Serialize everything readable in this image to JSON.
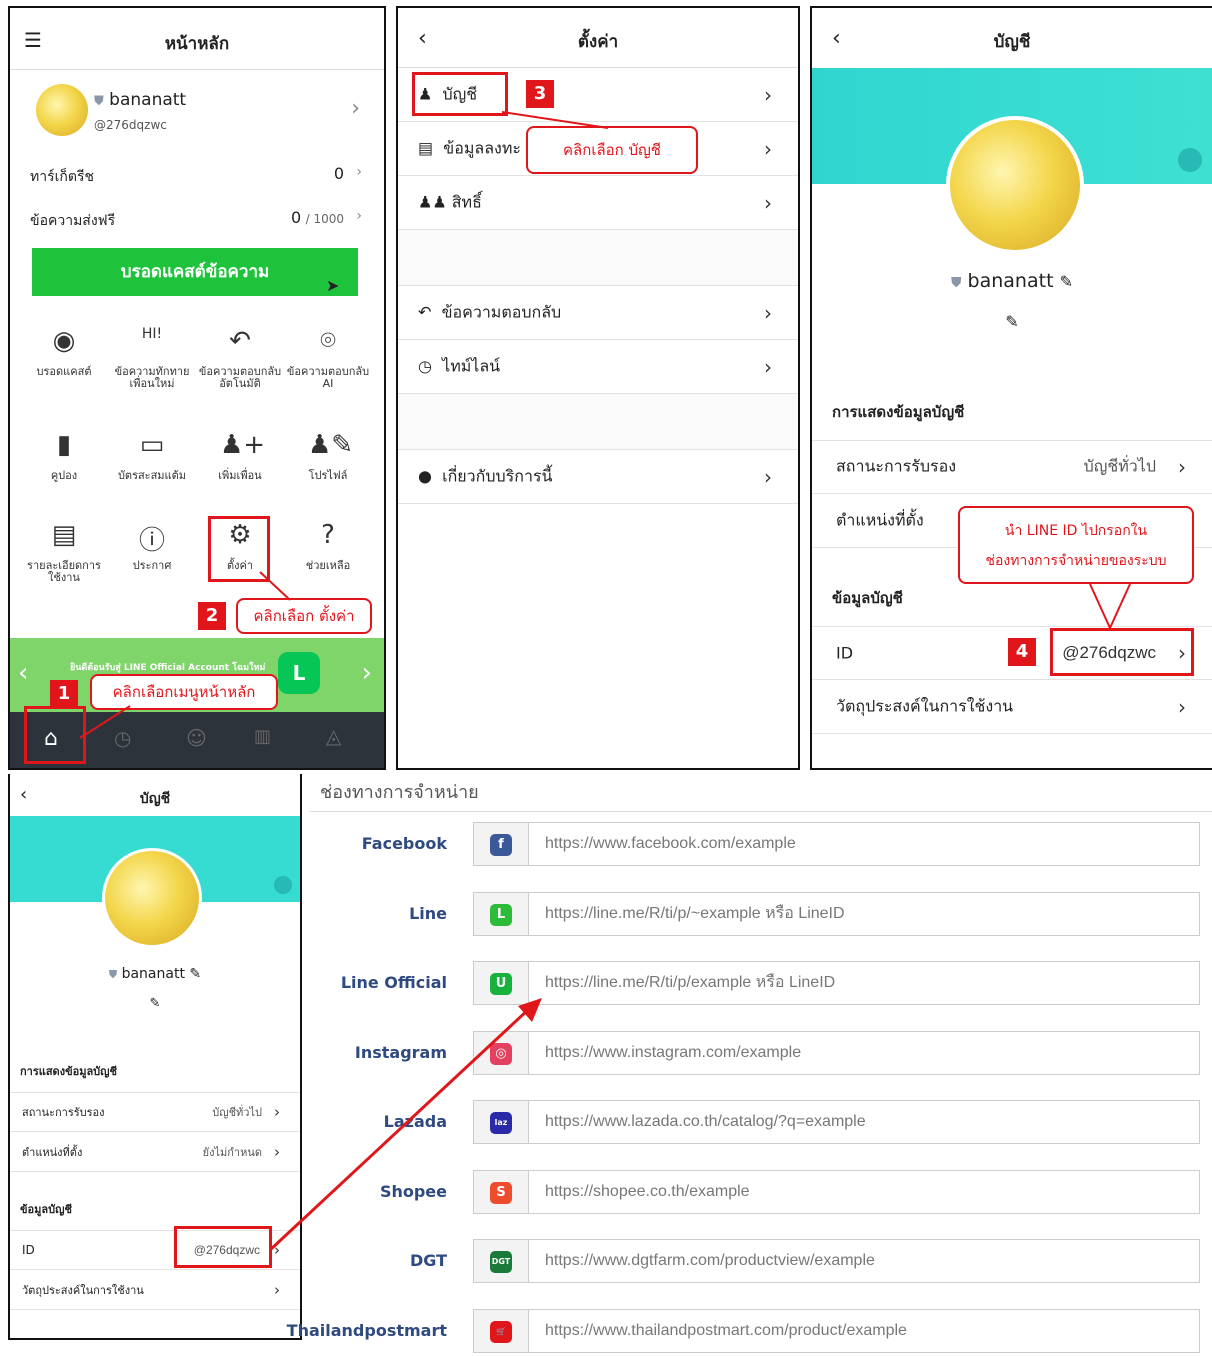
{
  "home": {
    "title": "หน้าหลัก",
    "account_name": "bananatt",
    "account_id": "@276dqzwc",
    "target_reach_label": "ทาร์เก็ตรีช",
    "target_reach_value": "0",
    "free_msg_label": "ข้อความส่งฟรี",
    "free_msg_value": "0",
    "free_msg_limit": "/ 1000",
    "broadcast_button": "บรอดแคสต์ข้อความ",
    "grid": [
      {
        "label": "บรอดแคสต์",
        "icon": "broadcast-icon"
      },
      {
        "label": "ข้อความทักทายเพื่อนใหม่",
        "icon": "hi-icon"
      },
      {
        "label": "ข้อความตอบกลับอัตโนมัติ",
        "icon": "reply-icon"
      },
      {
        "label": "ข้อความตอบกลับ AI",
        "icon": "bot-icon"
      },
      {
        "label": "คูปอง",
        "icon": "coupon-icon"
      },
      {
        "label": "บัตรสะสมแต้ม",
        "icon": "card-icon"
      },
      {
        "label": "เพิ่มเพื่อน",
        "icon": "add-friend-icon"
      },
      {
        "label": "โปรไฟล์",
        "icon": "profile-icon"
      },
      {
        "label": "รายละเอียดการใช้งาน",
        "icon": "usage-icon"
      },
      {
        "label": "ประกาศ",
        "icon": "info-icon"
      },
      {
        "label": "ตั้งค่า",
        "icon": "gear-icon"
      },
      {
        "label": "ช่วยเหลือ",
        "icon": "help-icon"
      }
    ],
    "banner_text": "ยินดีต้อนรับสู่ LINE Official Account โฉมใหม่",
    "step1_callout": "คลิกเลือกเมนูหน้าหลัก",
    "step2_callout": "คลิกเลือก ตั้งค่า",
    "step1_num": "1",
    "step2_num": "2"
  },
  "settings": {
    "title": "ตั้งค่า",
    "items_group1": [
      "บัญชี",
      "ข้อมูลลงทะ",
      "สิทธิ์"
    ],
    "items_group2": [
      "ข้อความตอบกลับ",
      "ไทม์ไลน์"
    ],
    "items_group3": [
      "เกี่ยวกับบริการนี้"
    ],
    "step3_callout": "คลิกเลือก บัญชี",
    "step3_num": "3"
  },
  "account": {
    "title": "บัญชี",
    "name": "bananatt",
    "section_display": "การแสดงข้อมูลบัญชี",
    "status_label": "สถานะการรับรอง",
    "status_value": "บัญชีทั่วไป",
    "location_label": "ตำแหน่งที่ตั้ง",
    "location_value": "ยังไม่กำหนด",
    "section_info": "ข้อมูลบัญชี",
    "id_label": "ID",
    "id_value": "@276dqzwc",
    "purpose_label": "วัตถุประสงค์ในการใช้งาน",
    "step4_callout_line1": "นำ LINE ID ไปกรอกใน",
    "step4_callout_line2": "ช่องทางการจำหน่ายของระบบ",
    "step4_num": "4"
  },
  "channels": {
    "heading": "ช่องทางการจำหน่าย",
    "rows": [
      {
        "label": "Facebook",
        "placeholder": "https://www.facebook.com/example",
        "icon": "facebook-icon",
        "color": "#3b5998",
        "glyph": "f"
      },
      {
        "label": "Line",
        "placeholder": "https://line.me/R/ti/p/~example หรือ LineID",
        "icon": "line-icon",
        "color": "#2dbb3a",
        "glyph": "L"
      },
      {
        "label": "Line Official",
        "placeholder": "https://line.me/R/ti/p/example หรือ LineID",
        "icon": "line-official-icon",
        "color": "#16b23b",
        "glyph": "U"
      },
      {
        "label": "Instagram",
        "placeholder": "https://www.instagram.com/example",
        "icon": "instagram-icon",
        "color": "#e4405f",
        "glyph": "◎"
      },
      {
        "label": "Lazada",
        "placeholder": "https://www.lazada.co.th/catalog/?q=example",
        "icon": "lazada-icon",
        "color": "#2b2aa8",
        "glyph": "laz"
      },
      {
        "label": "Shopee",
        "placeholder": "https://shopee.co.th/example",
        "icon": "shopee-icon",
        "color": "#ee4d2d",
        "glyph": "S"
      },
      {
        "label": "DGT",
        "placeholder": "https://www.dgtfarm.com/productview/example",
        "icon": "dgt-icon",
        "color": "#1a7a3a",
        "glyph": "DGT"
      },
      {
        "label": "Thailandpostmart",
        "placeholder": "https://www.thailandpostmart.com/product/example",
        "icon": "thailandpostmart-icon",
        "color": "#e0161b",
        "glyph": "🛒"
      }
    ]
  }
}
